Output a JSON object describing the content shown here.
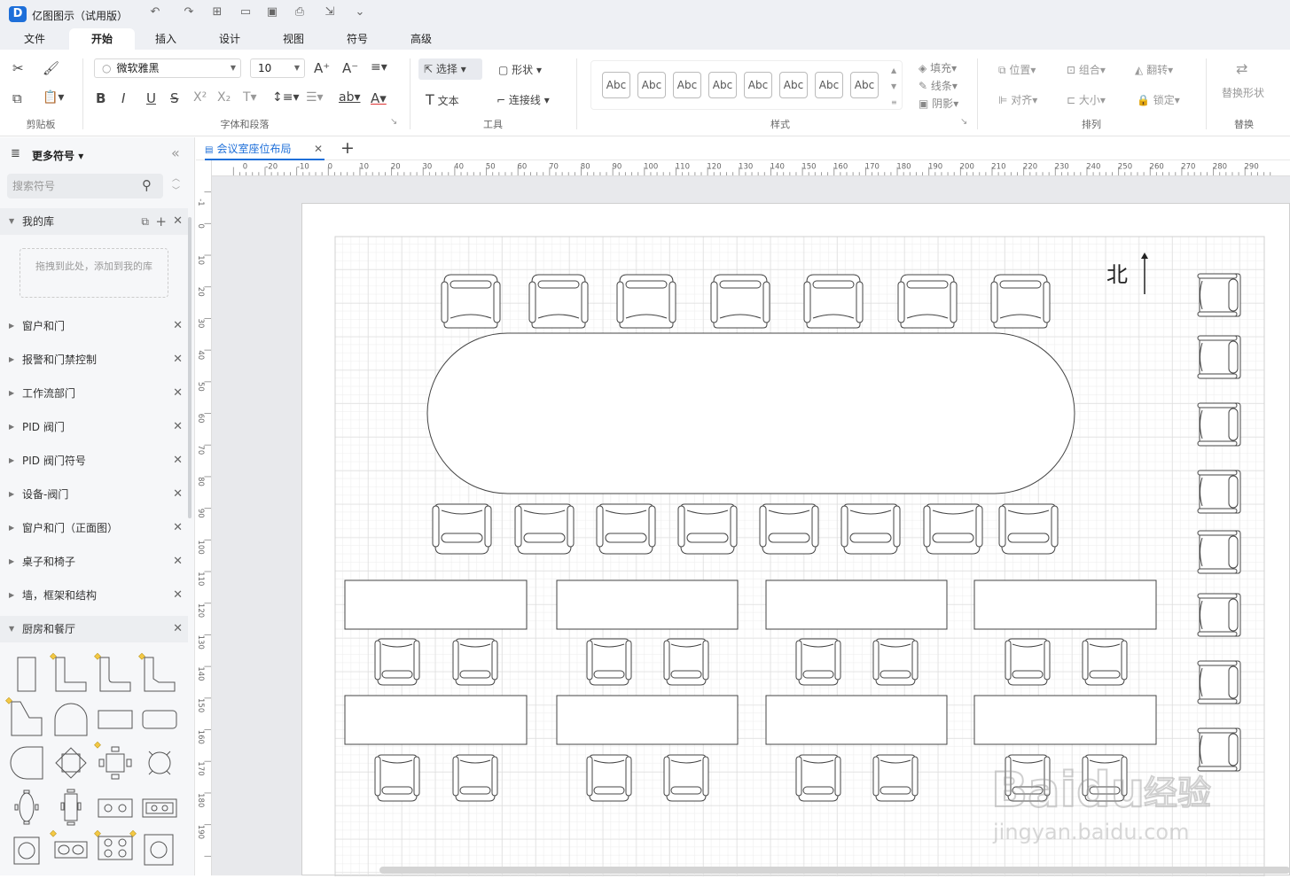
{
  "app": {
    "title": "亿图图示（试用版）",
    "logo": "D"
  },
  "quick_access": [
    "undo-icon",
    "redo-icon",
    "new-icon",
    "open-icon",
    "save-icon",
    "print-icon",
    "export-icon",
    "more-icon"
  ],
  "menus": [
    "文件",
    "开始",
    "插入",
    "设计",
    "视图",
    "符号",
    "高级"
  ],
  "active_menu": "开始",
  "ribbon": {
    "clipboard": {
      "group": "剪贴板"
    },
    "font": {
      "family": "微软雅黑",
      "size": "10",
      "group": "字体和段落"
    },
    "tools": {
      "select": "选择",
      "shape": "形状",
      "text": "文本",
      "connector": "连接线",
      "group": "工具"
    },
    "styles": {
      "abc": [
        "Abc",
        "Abc",
        "Abc",
        "Abc",
        "Abc",
        "Abc",
        "Abc",
        "Abc"
      ],
      "group": "样式"
    },
    "format": {
      "fill": "填充",
      "line": "线条",
      "shadow": "阴影"
    },
    "arrange": {
      "position": "位置",
      "group_btn": "组合",
      "flip": "翻转",
      "align": "对齐",
      "size": "大小",
      "lock": "锁定",
      "group": "排列"
    },
    "replace": {
      "label": "替换形状",
      "group": "替换"
    }
  },
  "left_panel": {
    "title": "更多符号",
    "search_placeholder": "搜索符号",
    "my_library": "我的库",
    "drop_hint": "拖拽到此处，添加到我的库",
    "categories": [
      "窗户和门",
      "报警和门禁控制",
      "工作流部门",
      "PID 阀门",
      "PID 阀门符号",
      "设备-阀门",
      "窗户和门（正面图）",
      "桌子和椅子",
      "墙，框架和结构"
    ],
    "expanded": "厨房和餐厅"
  },
  "document": {
    "tab": "会议室座位布局",
    "north_label": "北"
  },
  "rulers": {
    "h": [
      "-20",
      "-10",
      "0",
      "10",
      "20",
      "30",
      "40",
      "50",
      "60",
      "70",
      "80",
      "90",
      "100",
      "110",
      "120",
      "130",
      "140",
      "150",
      "160",
      "170",
      "180",
      "190",
      "200",
      "210",
      "220",
      "230",
      "240",
      "250",
      "260",
      "270",
      "280",
      "290"
    ],
    "v": [
      "-1",
      "0",
      "10",
      "20",
      "30",
      "40",
      "50",
      "60",
      "70",
      "80",
      "90",
      "100",
      "110",
      "120",
      "130",
      "140",
      "150",
      "160",
      "170",
      "180",
      "190"
    ]
  },
  "watermark": {
    "brand": "Baidu",
    "cn": "经验",
    "url": "jingyan.baidu.com"
  },
  "colors": {
    "accent": "#1e6fd9",
    "titlebar": "#eef0f4",
    "canvas": "#e8e9ec",
    "grid": "#e2e2e2"
  }
}
